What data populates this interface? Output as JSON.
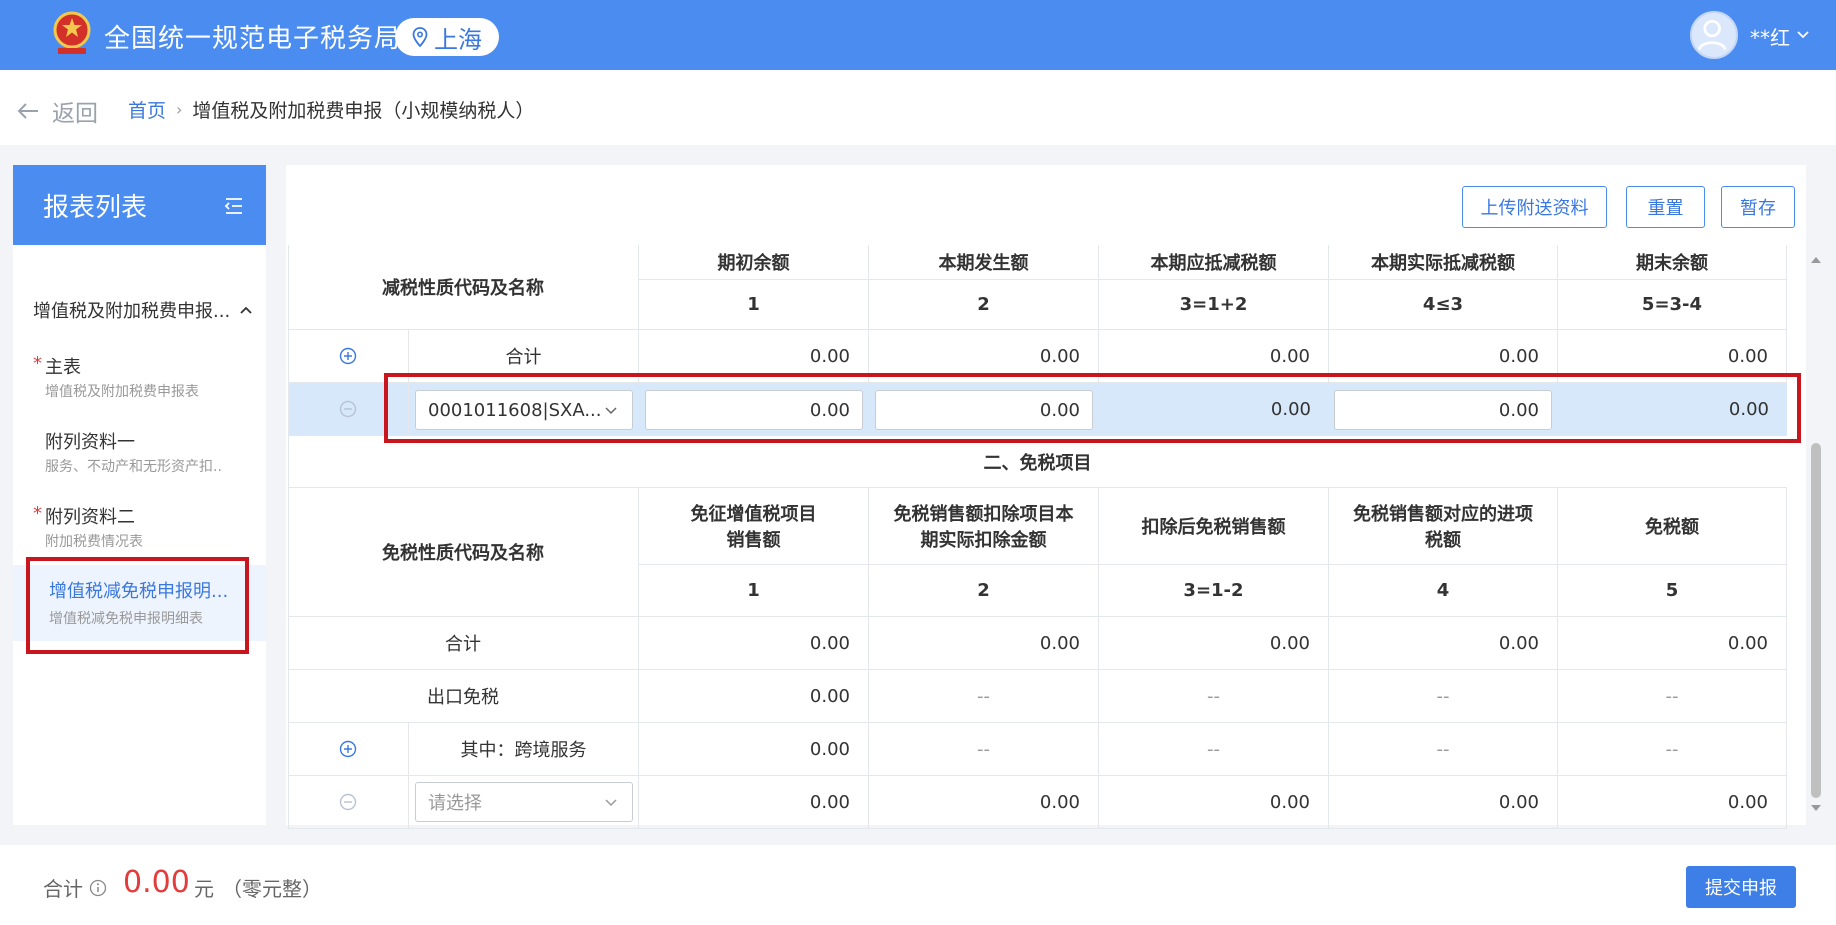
{
  "header": {
    "app_title": "全国统一规范电子税务局",
    "region": "上海",
    "username": "**红"
  },
  "breadcrumb": {
    "back": "返回",
    "home": "首页",
    "sep": "›",
    "current": "增值税及附加税费申报（小规模纳税人）"
  },
  "sidebar": {
    "title": "报表列表",
    "group": "增值税及附加税费申报...",
    "items": [
      {
        "star": "*",
        "name": "主表",
        "sub": "增值税及附加税费申报表"
      },
      {
        "star": "",
        "name": "附列资料一",
        "sub": "服务、不动产和无形资产扣.."
      },
      {
        "star": "*",
        "name": "附列资料二",
        "sub": "附加税费情况表"
      },
      {
        "star": "",
        "name": "增值税减免税申报明...",
        "sub": "增值税减免税申报明细表"
      }
    ]
  },
  "toolbar": {
    "upload": "上传附送资料",
    "reset": "重置",
    "save": "暂存"
  },
  "table1": {
    "label_header": "减税性质代码及名称",
    "columns": [
      {
        "title": "期初余额",
        "code": "1"
      },
      {
        "title": "本期发生额",
        "code": "2"
      },
      {
        "title": "本期应抵减税额",
        "code": "3=1+2"
      },
      {
        "title": "本期实际抵减税额",
        "code": "4≤3"
      },
      {
        "title": "期末余额",
        "code": "5=3-4"
      }
    ],
    "total_row": {
      "label": "合计",
      "values": [
        "0.00",
        "0.00",
        "0.00",
        "0.00",
        "0.00"
      ]
    },
    "edit_row": {
      "select": "0001011608|SXA...",
      "values": [
        "0.00",
        "0.00",
        "0.00",
        "0.00",
        "0.00"
      ]
    }
  },
  "section2_title": "二、免税项目",
  "table2": {
    "label_header": "免税性质代码及名称",
    "columns": [
      {
        "title1": "免征增值税项目",
        "title2": "销售额",
        "code": "1"
      },
      {
        "title1": "免税销售额扣除项目本",
        "title2": "期实际扣除金额",
        "code": "2"
      },
      {
        "title1": "扣除后免税销售额",
        "title2": "",
        "code": "3=1-2"
      },
      {
        "title1": "免税销售额对应的进项",
        "title2": "税额",
        "code": "4"
      },
      {
        "title1": "免税额",
        "title2": "",
        "code": "5"
      }
    ],
    "rows": [
      {
        "label": "合计",
        "values": [
          "0.00",
          "0.00",
          "0.00",
          "0.00",
          "0.00"
        ]
      },
      {
        "label": "出口免税",
        "values": [
          "0.00",
          "--",
          "--",
          "--",
          "--"
        ]
      },
      {
        "label": "其中：跨境服务",
        "values": [
          "0.00",
          "--",
          "--",
          "--",
          "--"
        ]
      },
      {
        "label": "请选择",
        "values": [
          "0.00",
          "0.00",
          "0.00",
          "0.00",
          "0.00"
        ]
      }
    ]
  },
  "footer": {
    "total_label": "合计",
    "total_amount": "0.00",
    "unit": "元",
    "words": "（零元整）",
    "submit": "提交申报"
  },
  "colors": {
    "brand": "#4b8cf0",
    "highlight": "#d7e8fb",
    "alert": "#c8161e",
    "amount": "#e23c3c"
  }
}
